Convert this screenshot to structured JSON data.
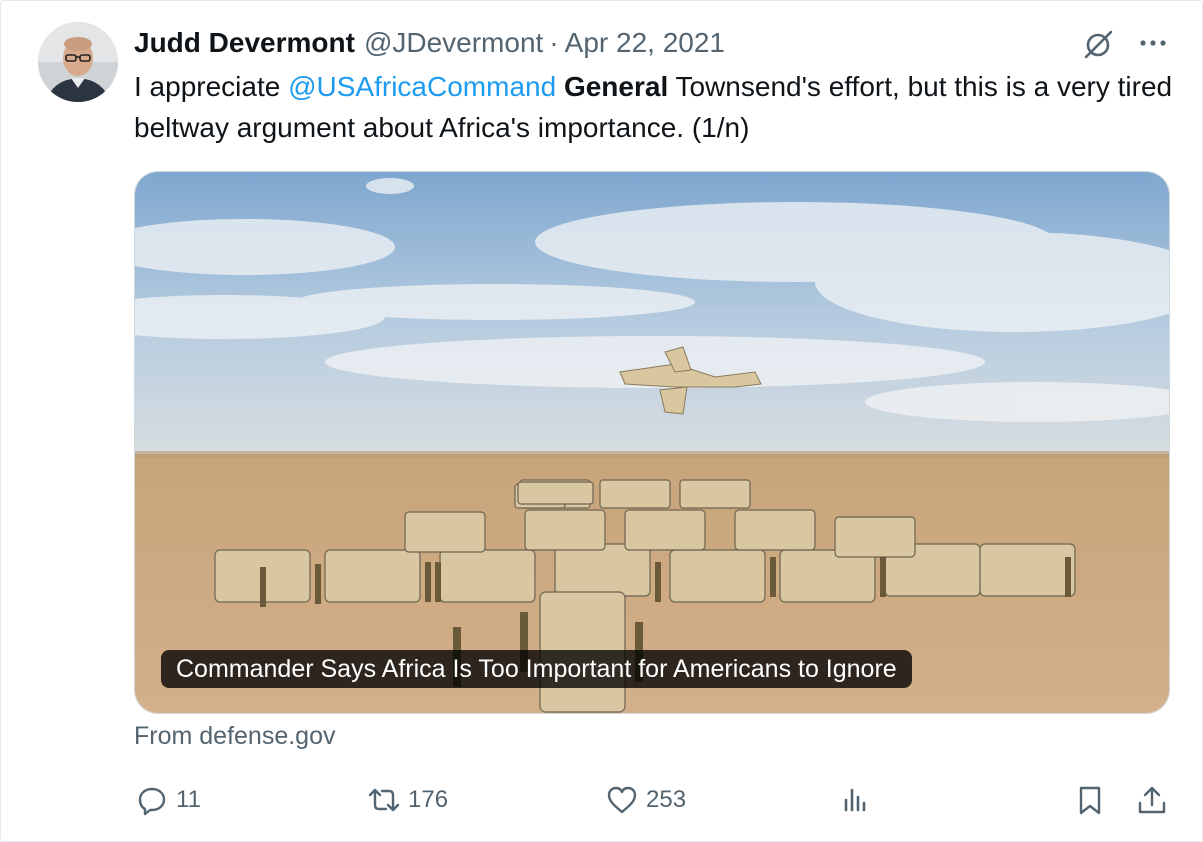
{
  "author": {
    "name": "Judd Devermont",
    "handle": "@JDevermont",
    "separator": "·",
    "date": "Apr 22, 2021"
  },
  "tweet": {
    "text_1": "I appreciate ",
    "mention": "@USAfricaCommand",
    "text_2": " ",
    "bold_word": "General",
    "text_3": " Townsend's effort, but this is a very tired beltway argument about Africa's importance. (1/n)"
  },
  "card": {
    "image_description_icon": "military-vehicles-desert-photo",
    "headline": "Commander Says Africa Is Too Important for Americans to Ignore",
    "source": "From defense.gov"
  },
  "actions": {
    "replies": "11",
    "retweets": "176",
    "likes": "253"
  },
  "icons": {
    "grok": "slashed-circle-icon",
    "more": "more-dots-icon",
    "reply": "reply-icon",
    "retweet": "retweet-icon",
    "like": "heart-icon",
    "views": "views-chart-icon",
    "bookmark": "bookmark-icon",
    "share": "share-icon"
  },
  "colors": {
    "accent": "#1d9bf0",
    "text": "#0f1419",
    "secondary": "#536471"
  }
}
